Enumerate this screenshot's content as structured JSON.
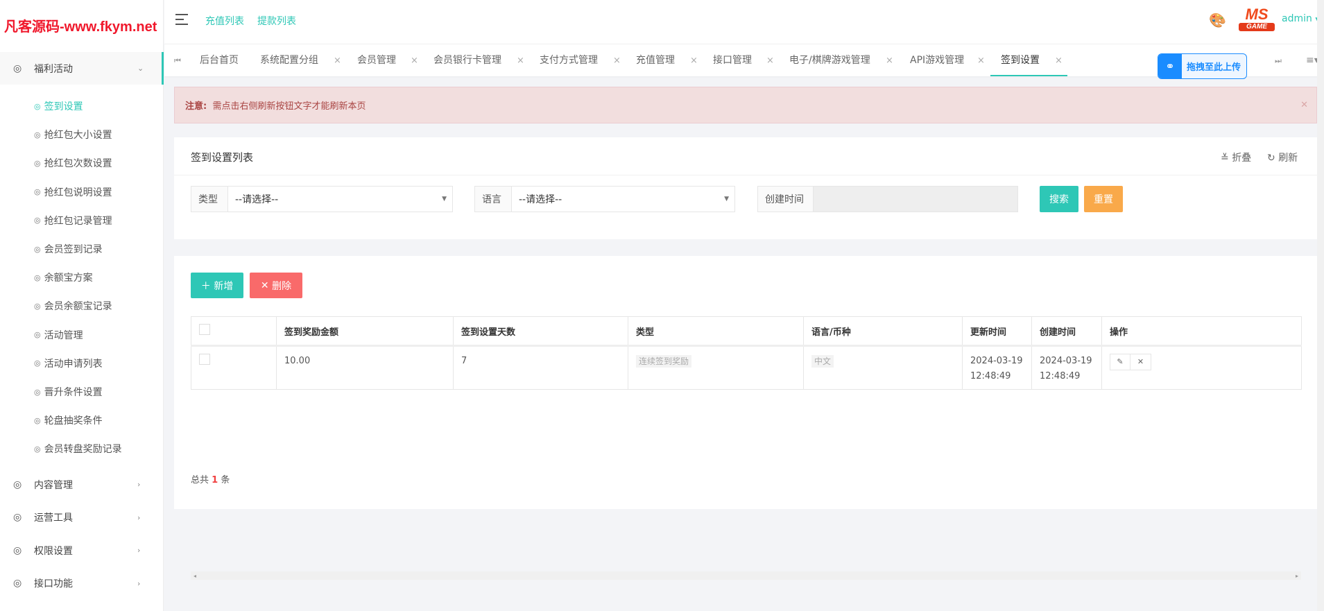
{
  "logo": "凡客源码-www.fkym.net",
  "header": {
    "links": [
      "充值列表",
      "提款列表"
    ],
    "user": "admin",
    "brand_logo": "MS GAME"
  },
  "sidebar": {
    "active_group": "福利活动",
    "sub_items": [
      "签到设置",
      "抢红包大小设置",
      "抢红包次数设置",
      "抢红包说明设置",
      "抢红包记录管理",
      "会员签到记录",
      "余额宝方案",
      "会员余额宝记录",
      "活动管理",
      "活动申请列表",
      "晋升条件设置",
      "轮盘抽奖条件",
      "会员转盘奖励记录"
    ],
    "groups": [
      "内容管理",
      "运营工具",
      "权限设置",
      "接口功能"
    ]
  },
  "tabs": [
    "后台首页",
    "系统配置分组",
    "会员管理",
    "会员银行卡管理",
    "支付方式管理",
    "充值管理",
    "接口管理",
    "电子/棋牌游戏管理",
    "API游戏管理",
    "签到设置"
  ],
  "upload_label": "拖拽至此上传",
  "alert": {
    "prefix": "注意:",
    "text": "需点击右侧刷新按钮文字才能刷新本页"
  },
  "panel": {
    "title": "签到设置列表",
    "collapse": "折叠",
    "refresh": "刷新"
  },
  "filters": {
    "type_label": "类型",
    "type_value": "--请选择--",
    "lang_label": "语言",
    "lang_value": "--请选择--",
    "time_label": "创建时间",
    "search": "搜索",
    "reset": "重置"
  },
  "actions": {
    "add": "新增",
    "delete": "删除"
  },
  "table": {
    "headers": [
      "签到奖励金额",
      "签到设置天数",
      "类型",
      "语言/币种",
      "更新时间",
      "创建时间",
      "操作"
    ],
    "rows": [
      {
        "amount": "10.00",
        "days": "7",
        "type": "连续签到奖励",
        "lang": "中文",
        "updated_date": "2024-03-19",
        "updated_time": "12:48:49",
        "created_date": "2024-03-19",
        "created_time": "12:48:49"
      }
    ]
  },
  "footer": {
    "prefix": "总共",
    "count": "1",
    "suffix": "条"
  }
}
